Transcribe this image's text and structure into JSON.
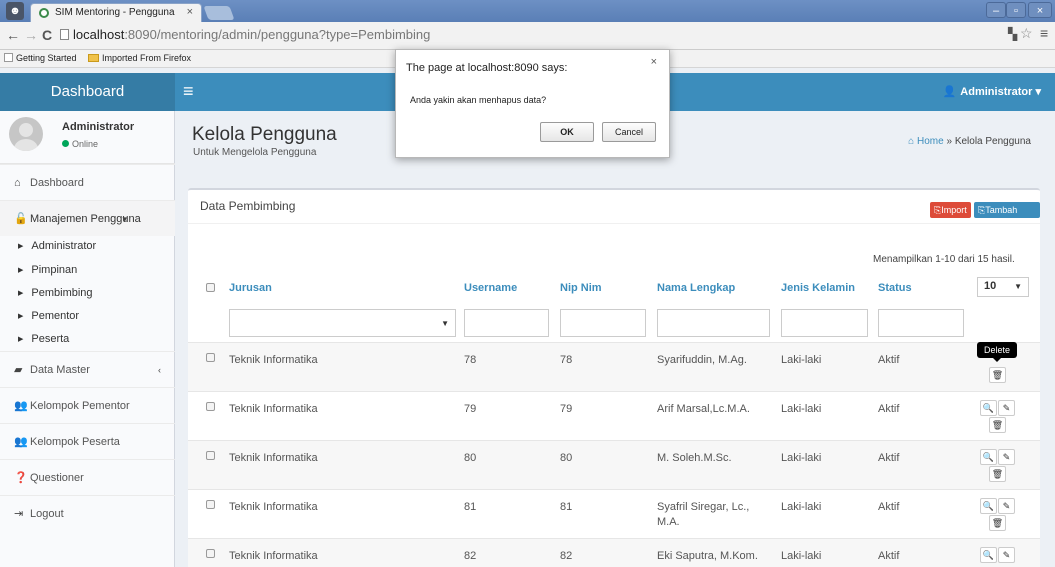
{
  "browser": {
    "tab_title": "SIM Mentoring - Pengguna",
    "tab_close": "×",
    "url_host": "localhost",
    "url_rest": ":8090/mentoring/admin/pengguna?type=Pembimbing",
    "bookmarks": [
      "Getting Started",
      "Imported From Firefox"
    ]
  },
  "header": {
    "brand": "Dashboard",
    "user_menu": "Administrator"
  },
  "sidebar": {
    "user_name": "Administrator",
    "user_status": "Online",
    "menu": {
      "dashboard": "Dashboard",
      "manajemen": "Manajemen Pengguna",
      "data_master": "Data Master",
      "kelompok_pementor": "Kelompok Pementor",
      "kelompok_peserta": "Kelompok Peserta",
      "questioner": "Questioner",
      "logout": "Logout"
    },
    "submenu": [
      "Administrator",
      "Pimpinan",
      "Pembimbing",
      "Pementor",
      "Peserta"
    ]
  },
  "page": {
    "title": "Kelola Pengguna",
    "subtitle": "Untuk Mengelola Pengguna",
    "breadcrumb_home": "Home",
    "breadcrumb_sep": "»",
    "breadcrumb_current": "Kelola Pengguna"
  },
  "box": {
    "title": "Data Pembimbing",
    "import_label": "Import",
    "add_label": "Tambah Data",
    "summary": "Menampilkan 1-10 dari 15 hasil.",
    "page_size": "10",
    "tooltip": "Delete"
  },
  "table": {
    "headers": {
      "jurusan": "Jurusan",
      "username": "Username",
      "nip": "Nip Nim",
      "nama": "Nama Lengkap",
      "jk": "Jenis Kelamin",
      "status": "Status"
    },
    "rows": [
      {
        "jurusan": "Teknik Informatika",
        "username": "78",
        "nip": "78",
        "nama": "Syarifuddin, M.Ag.",
        "jk": "Laki-laki",
        "status": "Aktif"
      },
      {
        "jurusan": "Teknik Informatika",
        "username": "79",
        "nip": "79",
        "nama": "Arif Marsal,Lc.M.A.",
        "jk": "Laki-laki",
        "status": "Aktif"
      },
      {
        "jurusan": "Teknik Informatika",
        "username": "80",
        "nip": "80",
        "nama": "M. Soleh.M.Sc.",
        "jk": "Laki-laki",
        "status": "Aktif"
      },
      {
        "jurusan": "Teknik Informatika",
        "username": "81",
        "nip": "81",
        "nama": "Syafril Siregar, Lc., M.A.",
        "jk": "Laki-laki",
        "status": "Aktif"
      },
      {
        "jurusan": "Teknik Informatika",
        "username": "82",
        "nip": "82",
        "nama": "Eki Saputra, M.Kom.",
        "jk": "Laki-laki",
        "status": "Aktif"
      }
    ]
  },
  "dialog": {
    "title": "The page at localhost:8090 says:",
    "message": "Anda yakin akan menhapus data?",
    "ok": "OK",
    "cancel": "Cancel",
    "close": "×"
  }
}
